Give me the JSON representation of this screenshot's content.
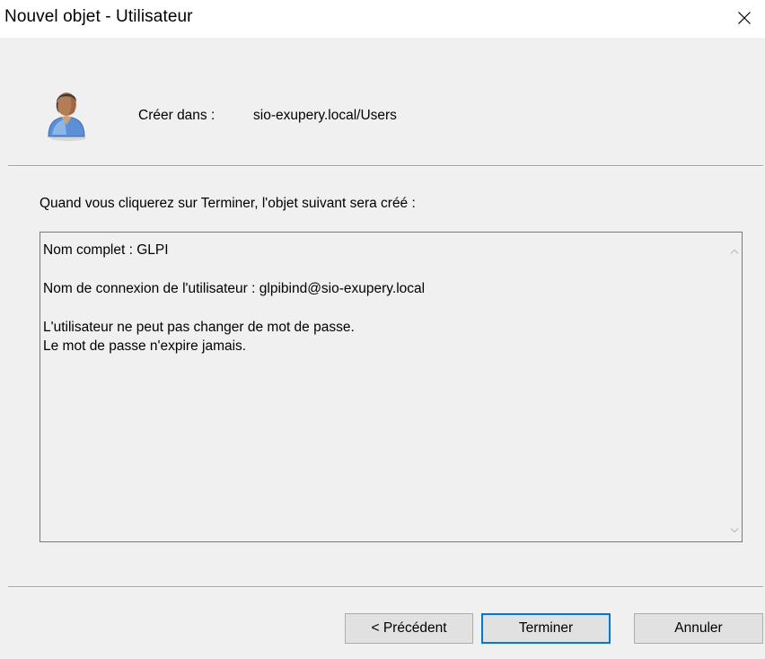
{
  "window": {
    "title": "Nouvel objet - Utilisateur",
    "close_glyph": "×"
  },
  "header": {
    "icon": "user-icon",
    "create_label": "Créer dans :",
    "create_path": "sio-exupery.local/Users"
  },
  "summary": {
    "intro": "Quand vous cliquerez sur Terminer, l'objet suivant sera créé :",
    "full_name": "Nom complet : GLPI",
    "logon_name": "Nom de connexion de l'utilisateur : glpibind@sio-exupery.local",
    "password_line_1": "L'utilisateur ne peut pas changer de mot de passe.",
    "password_line_2": "Le mot de passe n'expire jamais."
  },
  "buttons": {
    "previous": "< Précédent",
    "finish": "Terminer",
    "cancel": "Annuler"
  },
  "colors": {
    "dialog_bg": "#f0f0f0",
    "default_button_border": "#0078d7"
  }
}
